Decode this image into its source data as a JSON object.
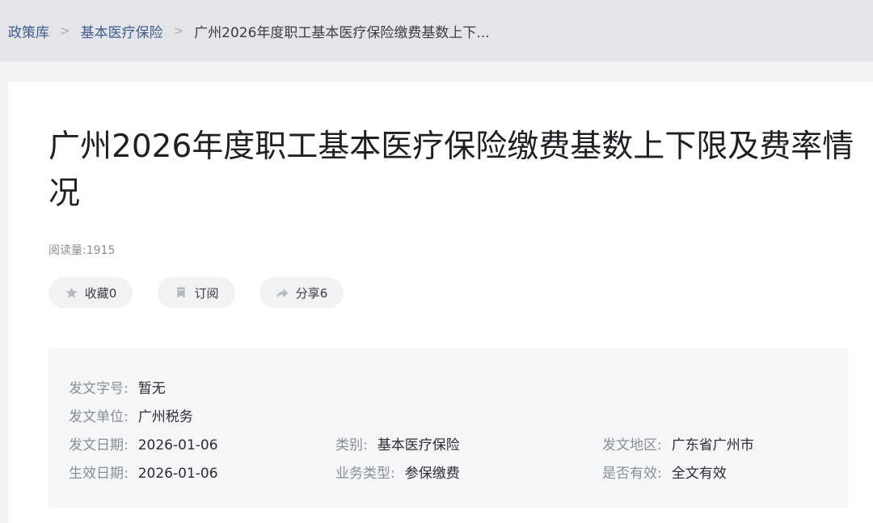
{
  "breadcrumb": {
    "items": [
      "政策库",
      "基本医疗保险"
    ],
    "current": "广州2026年度职工基本医疗保险缴费基数上下..."
  },
  "article": {
    "title": "广州2026年度职工基本医疗保险缴费基数上下限及费率情况",
    "read_count": "阅读量:1915"
  },
  "actions": {
    "favorite": "收藏0",
    "subscribe": "订阅",
    "share": "分享6"
  },
  "meta": {
    "doc_number": {
      "label": "发文字号:",
      "value": "暂无"
    },
    "issuer": {
      "label": "发文单位:",
      "value": "广州税务"
    },
    "issue_date": {
      "label": "发文日期:",
      "value": "2026-01-06"
    },
    "category": {
      "label": "类别:",
      "value": "基本医疗保险"
    },
    "region": {
      "label": "发文地区:",
      "value": "广东省广州市"
    },
    "effective_date": {
      "label": "生效日期:",
      "value": "2026-01-06"
    },
    "business_type": {
      "label": "业务类型:",
      "value": "参保缴费"
    },
    "validity": {
      "label": "是否有效:",
      "value": "全文有效"
    }
  },
  "colors": {
    "link": "#3f5a8c",
    "icon": "#b7bac0"
  }
}
